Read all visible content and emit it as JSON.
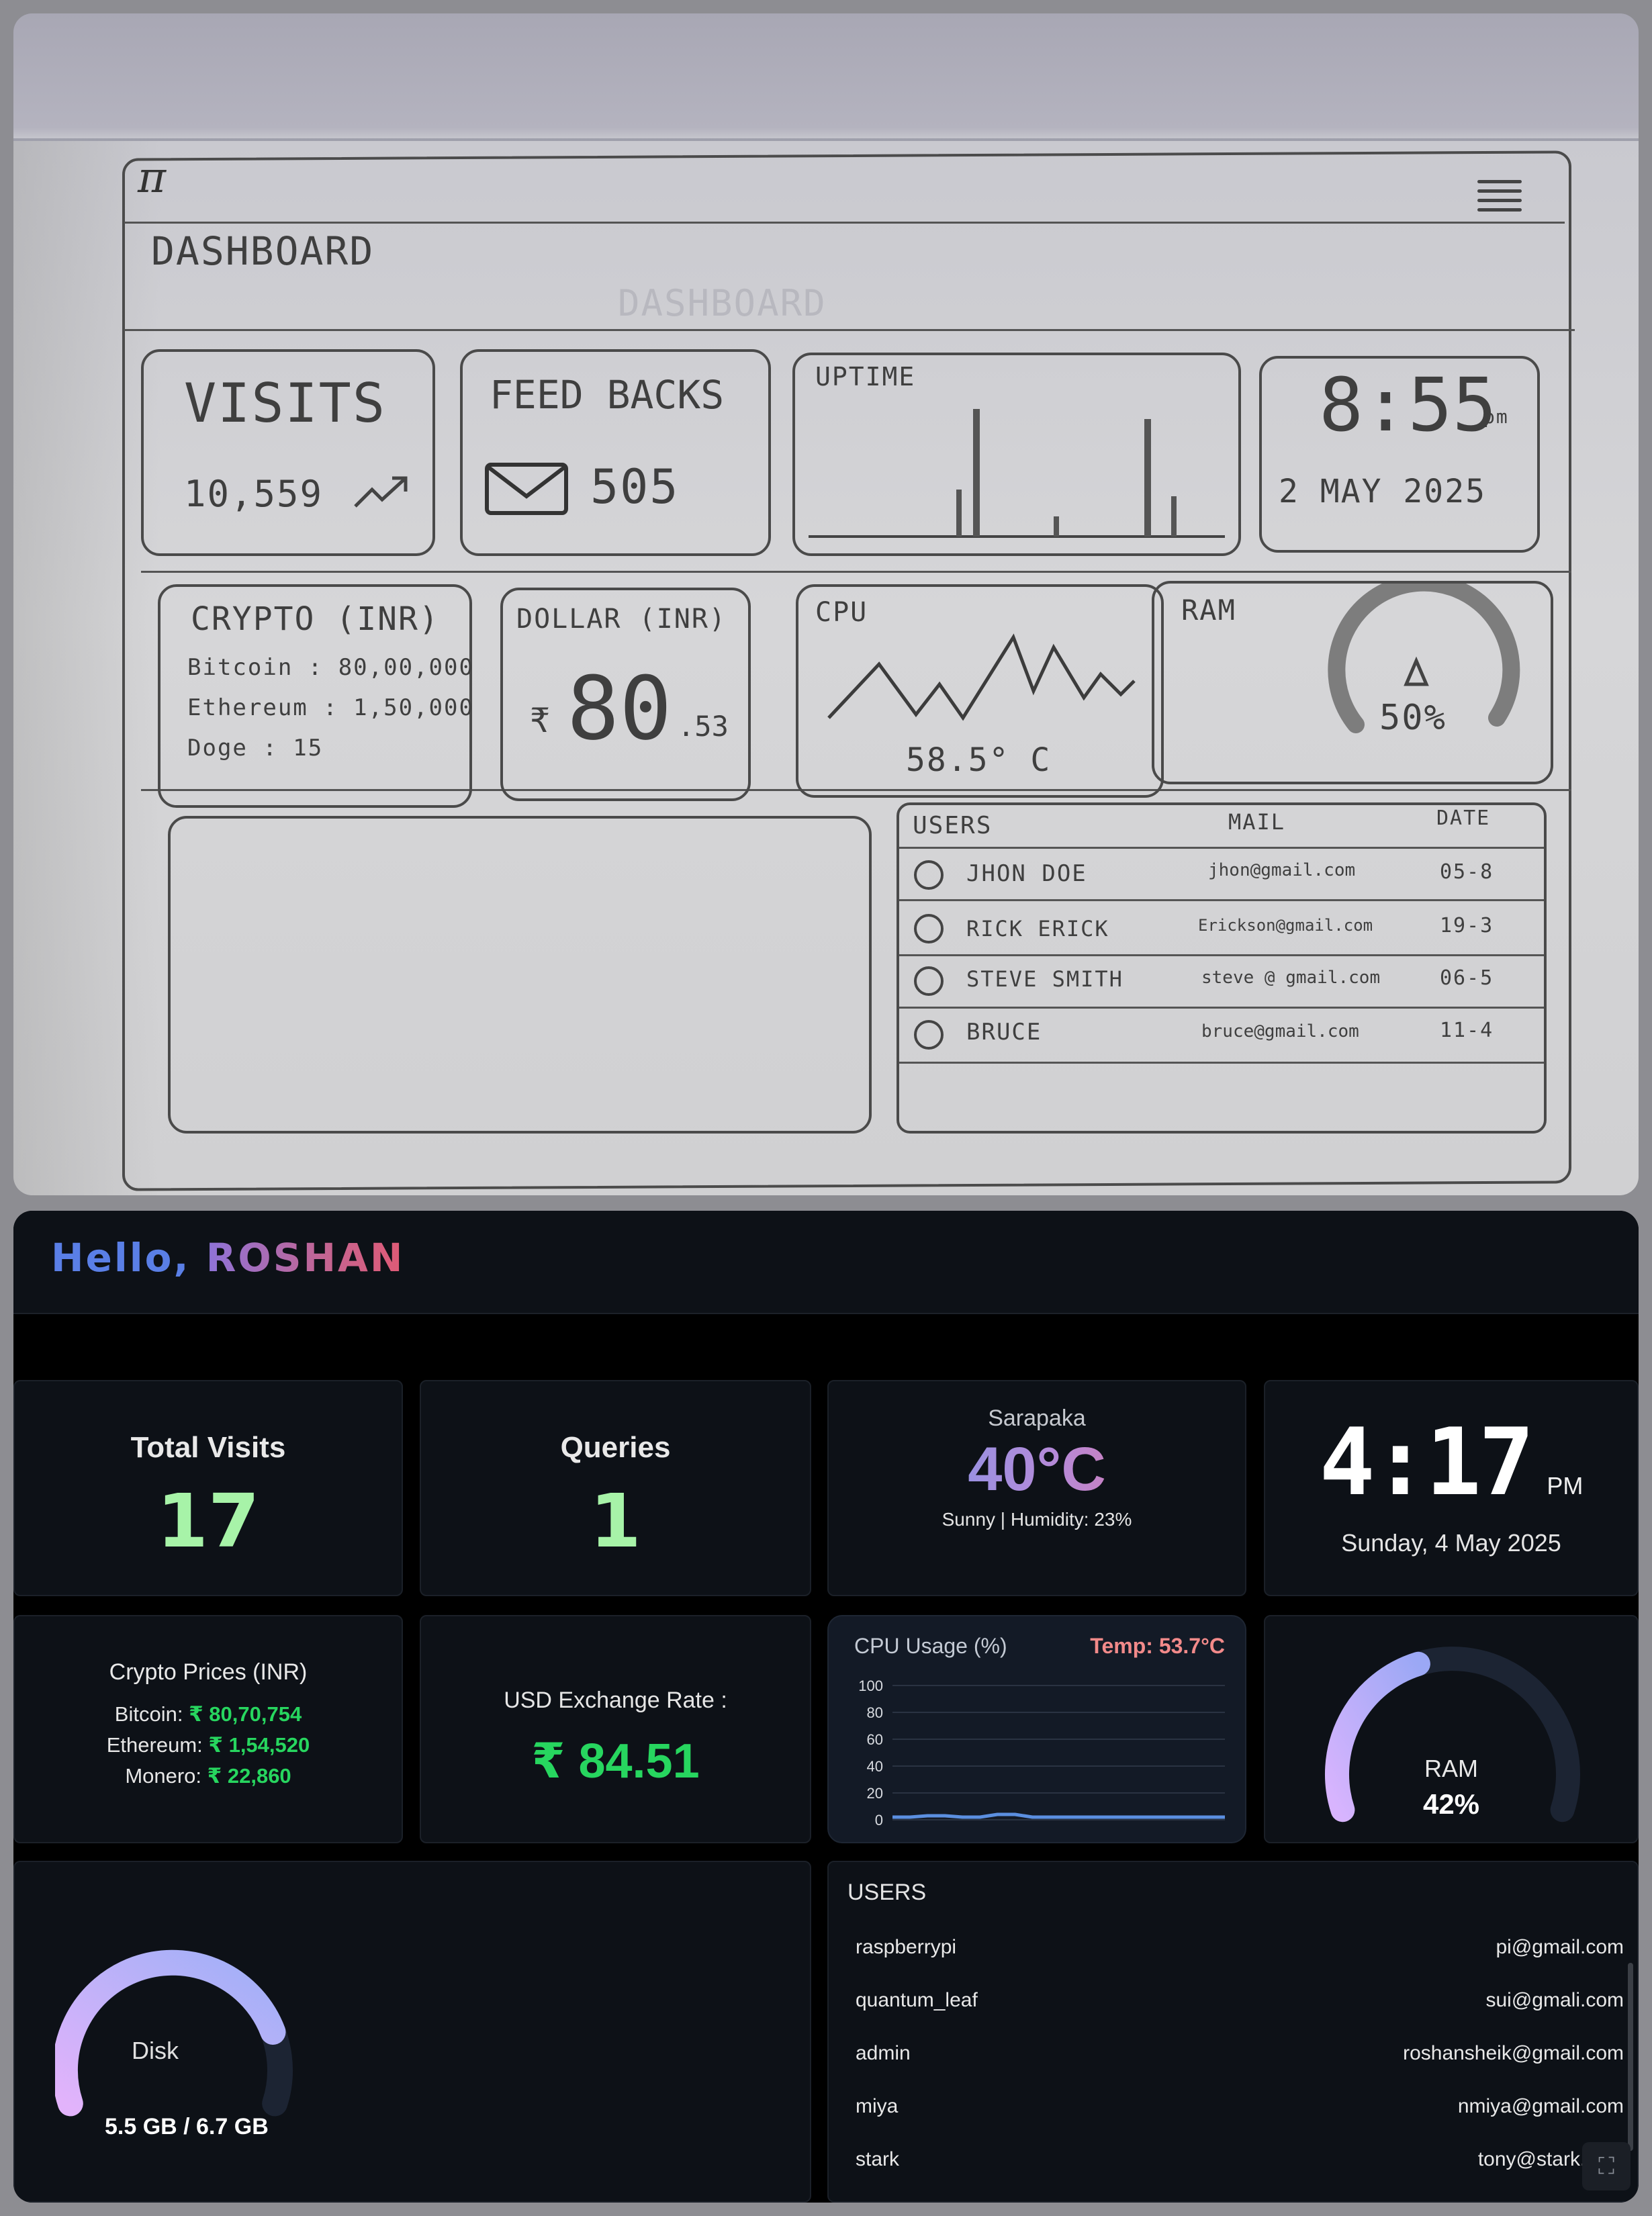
{
  "sketch": {
    "logo": "π",
    "title": "DASHBOARD",
    "ghost_title": "DASHBOARD",
    "visits": {
      "label": "VISITS",
      "value": "10,559"
    },
    "feedbacks": {
      "label": "FEED BACKS",
      "value": "505"
    },
    "uptime": {
      "label": "UPTIME"
    },
    "clock": {
      "time": "8:55",
      "ampm": "pm",
      "date": "2 MAY 2025"
    },
    "crypto": {
      "label": "CRYPTO (INR)",
      "rows": [
        "Bitcoin : 80,00,000",
        "Ethereum : 1,50,000",
        "Doge : 15"
      ]
    },
    "dollar": {
      "label": "DOLLAR (INR)",
      "symbol": "₹",
      "value": "80",
      "decimals": ".53"
    },
    "cpu": {
      "label": "CPU",
      "temp": "58.5° C"
    },
    "ram": {
      "label": "RAM",
      "value": "50%"
    },
    "users_table": {
      "headers": [
        "USERS",
        "MAIL",
        "DATE"
      ],
      "rows": [
        {
          "name": "JHON DOE",
          "mail": "jhon@gmail.com",
          "date": "05-8"
        },
        {
          "name": "RICK ERICK",
          "mail": "Erickson@gmail.com",
          "date": "19-3"
        },
        {
          "name": "STEVE SMITH",
          "mail": "steve @ gmail.com",
          "date": "06-5"
        },
        {
          "name": "BRUCE",
          "mail": "bruce@gmail.com",
          "date": "11-4"
        }
      ]
    }
  },
  "dashboard": {
    "greeting_word": "Hello,",
    "greeting_name": "ROSHAN",
    "visits": {
      "title": "Total Visits",
      "value": "17"
    },
    "queries": {
      "title": "Queries",
      "value": "1"
    },
    "weather": {
      "city": "Sarapaka",
      "temp": "40°C",
      "details": "Sunny | Humidity: 23%"
    },
    "clock": {
      "time": "4:17",
      "ampm": "PM",
      "date": "Sunday, 4 May 2025"
    },
    "crypto": {
      "title": "Crypto Prices (INR)",
      "rows": [
        {
          "coin": "Bitcoin:",
          "price": "₹ 80,70,754"
        },
        {
          "coin": "Ethereum:",
          "price": "₹ 1,54,520"
        },
        {
          "coin": "Monero:",
          "price": "₹ 22,860"
        }
      ]
    },
    "usd": {
      "title": "USD Exchange Rate :",
      "value": "₹ 84.51"
    },
    "cpu": {
      "title": "CPU Usage (%)",
      "temp": "Temp: 53.7°C"
    },
    "ram": {
      "label": "RAM",
      "value": "42%",
      "fraction": 0.42
    },
    "disk": {
      "label": "Disk",
      "value": "5.5 GB / 6.7 GB",
      "fraction": 0.82
    },
    "users": {
      "title": "USERS",
      "rows": [
        {
          "name": "raspberrypi",
          "mail": "pi@gmail.com"
        },
        {
          "name": "quantum_leaf",
          "mail": "sui@gmali.com"
        },
        {
          "name": "admin",
          "mail": "roshansheik@gmail.com"
        },
        {
          "name": "miya",
          "mail": "nmiya@gmail.com"
        },
        {
          "name": "stark",
          "mail": "tony@stark.com"
        }
      ]
    },
    "colors": {
      "bg": "#000000",
      "card": "#0d1117",
      "accent_green": "#27d65f",
      "soft_green": "#a7f3a8",
      "line": "#5b8fe0"
    }
  },
  "chart_data": {
    "type": "line",
    "ylim": [
      0,
      100
    ],
    "y_ticks": [
      0,
      20,
      40,
      60,
      80,
      100
    ],
    "x": [
      1,
      2,
      3,
      4,
      5,
      6,
      7,
      8,
      9,
      10,
      11,
      12,
      13,
      14,
      15,
      16,
      17,
      18,
      19,
      20
    ],
    "series": [
      {
        "values": [
          2,
          2,
          3,
          3,
          2,
          2,
          4,
          4,
          2,
          2,
          2,
          2,
          2,
          2,
          2,
          2,
          2,
          2,
          2,
          2
        ]
      }
    ]
  }
}
